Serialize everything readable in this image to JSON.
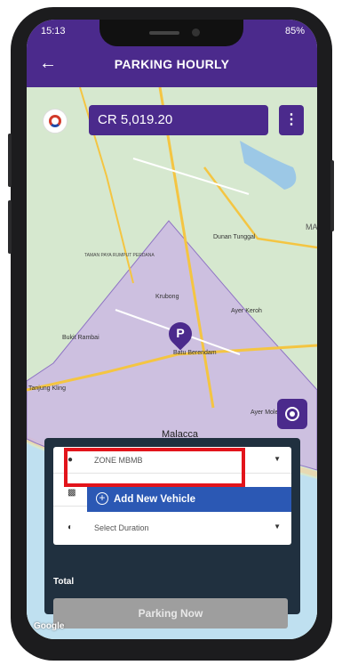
{
  "status_bar": {
    "time": "15:13",
    "battery": "85%"
  },
  "header": {
    "title": "PARKING HOURLY",
    "back_icon": "arrow-left-icon"
  },
  "balance": {
    "amount": "CR 5,019.20",
    "menu_icon": "kebab-menu-icon"
  },
  "map": {
    "labels": [
      "Dunan Tunggal",
      "TAMAN PAYA RUMPUT PERDANA",
      "Krubong",
      "Ayer Keroh",
      "Bukit Rambai",
      "Batu Berendam",
      "Tanjung Kling",
      "Ayer Molek",
      "Malacca",
      "MA"
    ],
    "parking_marker": "P",
    "attribution": "Google",
    "zone_color": "#c9b3e6"
  },
  "form": {
    "zone_value": "ZONE MBMB",
    "vehicle_option": "Add New Vehicle",
    "duration_placeholder": "Select Duration",
    "total_label": "Total",
    "submit_label": "Parking Now"
  },
  "colors": {
    "primary": "#4b2a8c",
    "panel": "#20303f",
    "dropdown_highlight": "#2b58b4",
    "annotation": "#e2141b",
    "disabled_button": "#9e9e9e"
  }
}
